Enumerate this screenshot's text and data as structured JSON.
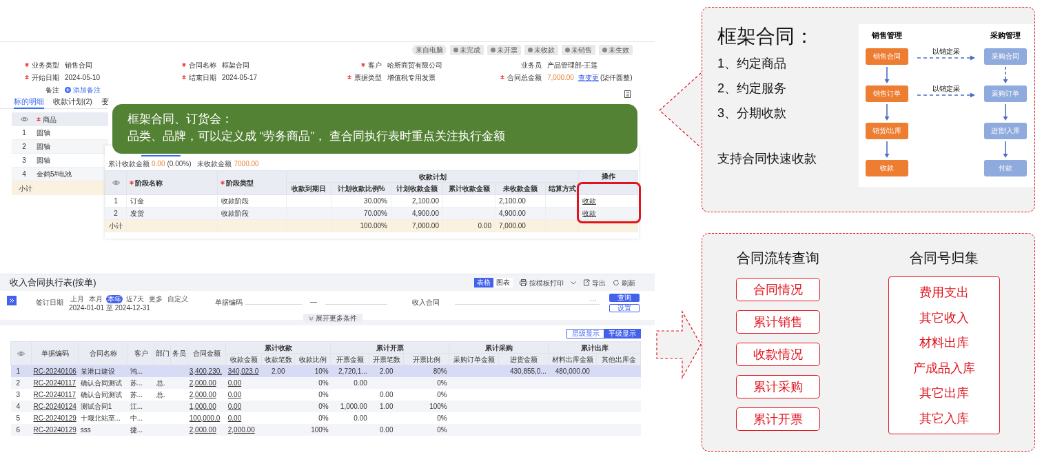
{
  "contract": {
    "status_tags": [
      {
        "label": "来自电脑",
        "kind": "source"
      },
      {
        "label": "未完成",
        "kind": "status"
      },
      {
        "label": "未开票",
        "kind": "status"
      },
      {
        "label": "未收款",
        "kind": "status"
      },
      {
        "label": "未销售",
        "kind": "status"
      },
      {
        "label": "未生效",
        "kind": "status"
      }
    ],
    "fields": [
      {
        "label": "业务类型",
        "value": "销售合同",
        "required": true,
        "kind": "text"
      },
      {
        "label": "合同名称",
        "value": "框架合同",
        "required": true,
        "kind": "text"
      },
      {
        "label": "客户",
        "value": "哈斯商贸有限公司",
        "required": true,
        "kind": "text"
      },
      {
        "label": "业务员",
        "value": "产品管理部-王莲",
        "required": false,
        "kind": "text"
      },
      {
        "label": "开始日期",
        "value": "2024-05-10",
        "required": true,
        "kind": "text"
      },
      {
        "label": "结束日期",
        "value": "2024-05-17",
        "required": true,
        "kind": "text"
      },
      {
        "label": "票据类型",
        "value": "增值税专用发票",
        "required": true,
        "kind": "text"
      },
      {
        "label": "合同总金额",
        "value": "7,000.00",
        "required": true,
        "kind": "amount",
        "link": "查变更",
        "note": "(柒仟圆整)"
      },
      {
        "label": "备注",
        "required": false,
        "kind": "action",
        "action": "添加备注"
      }
    ],
    "tabs": [
      {
        "label": "标的明细",
        "selected": true
      },
      {
        "label": "收款计划(2)",
        "selected": false
      },
      {
        "label": "变",
        "selected": false
      }
    ],
    "product_table": {
      "column": {
        "label": "商品",
        "required": true
      },
      "rows": [
        {
          "index": "1",
          "product": "圆轴"
        },
        {
          "index": "2",
          "product": "圆轴"
        },
        {
          "index": "3",
          "product": "圆轴"
        },
        {
          "index": "4",
          "product": "金鹤5#电池"
        }
      ],
      "subtotal_label": "小计"
    }
  },
  "payment_plan": {
    "summary": {
      "received_label": "累计收款金额",
      "received_value": "0.00",
      "received_pct": "(0.00%)",
      "outstanding_label": "未收款金额",
      "outstanding_value": "7000.00"
    },
    "group_header": "收款计划",
    "columns": [
      {
        "label": "阶段名称",
        "required": true,
        "kind": "text",
        "highlighted": false
      },
      {
        "label": "阶段类型",
        "required": true,
        "kind": "text",
        "highlighted": false
      },
      {
        "label": "收款到期日",
        "required": false,
        "kind": "text",
        "highlighted": false
      },
      {
        "label": "计划收款比例%",
        "required": false,
        "kind": "number",
        "highlighted": false
      },
      {
        "label": "计划收款金额",
        "required": false,
        "kind": "number",
        "highlighted": false
      },
      {
        "label": "累计收款金额",
        "required": false,
        "kind": "number",
        "highlighted": false
      },
      {
        "label": "未收款金额",
        "required": false,
        "kind": "text",
        "highlighted": false
      },
      {
        "label": "结算方式",
        "required": false,
        "kind": "text",
        "highlighted": false
      },
      {
        "label": "操作",
        "required": false,
        "kind": "action",
        "highlighted": true
      }
    ],
    "rows": [
      {
        "index": "1",
        "cells": [
          "订金",
          "收款阶段",
          null,
          "30.00%",
          "2,100.00",
          null,
          "2,100.00",
          null,
          "收款"
        ]
      },
      {
        "index": "2",
        "cells": [
          "发货",
          "收款阶段",
          null,
          "70.00%",
          "4,900.00",
          null,
          "4,900.00",
          null,
          "收款"
        ]
      }
    ],
    "subtotal": {
      "label": "小计",
      "cells": [
        null,
        null,
        null,
        "100.00%",
        "7,000.00",
        "0.00",
        "7,000.00",
        null,
        null
      ]
    }
  },
  "callout": {
    "title": "框架合同、订货会：",
    "body": "品类、品牌，可以定义成 “劳务商品”， 查合同执行表时重点关注执行金额"
  },
  "report": {
    "title": "收入合同执行表(按单)",
    "view_tabs": [
      {
        "label": "表格",
        "selected": true
      },
      {
        "label": "图表",
        "selected": false
      }
    ],
    "toolbar": [
      {
        "label": "按模板打印",
        "kind": "print"
      },
      {
        "label": "导出",
        "kind": "export"
      },
      {
        "label": "刷新",
        "kind": "refresh"
      }
    ],
    "filters": {
      "date_label": "签订日期",
      "date_presets": [
        {
          "label": "上月",
          "selected": false
        },
        {
          "label": "本月",
          "selected": false
        },
        {
          "label": "本年",
          "selected": true
        },
        {
          "label": "近7天",
          "selected": false
        },
        {
          "label": "更多",
          "selected": false
        },
        {
          "label": "自定义",
          "selected": false
        }
      ],
      "date_range": "2024-01-01 至 2024-12-31",
      "code_label": "单据编码",
      "range_separator": "—",
      "contract_label": "收入合同",
      "contract_more": "···"
    },
    "buttons": [
      {
        "label": "查询",
        "kind": "primary"
      },
      {
        "label": "设置",
        "kind": "secondary"
      }
    ],
    "expand_label": "展开更多条件",
    "display_modes": [
      {
        "label": "层级显示",
        "selected": false
      },
      {
        "label": "平级显示",
        "selected": true
      }
    ],
    "table": {
      "leading_columns": [
        {
          "label": "单据编码",
          "kind": "link"
        },
        {
          "label": "合同名称",
          "kind": "text"
        },
        {
          "label": "客户",
          "kind": "text"
        },
        {
          "label": "部门",
          "kind": "text"
        },
        {
          "label": "务员",
          "kind": "text"
        },
        {
          "label": "合同金额",
          "kind": "link"
        }
      ],
      "groups": [
        {
          "label": "累计收款",
          "columns": [
            {
              "label": "收款金额",
              "kind": "link"
            },
            {
              "label": "收款笔数",
              "kind": "count"
            },
            {
              "label": "收款比例",
              "kind": "number"
            }
          ]
        },
        {
          "label": "累计开票",
          "columns": [
            {
              "label": "开票金额",
              "kind": "number"
            },
            {
              "label": "开票笔数",
              "kind": "count"
            },
            {
              "label": "开票比例",
              "kind": "number"
            }
          ]
        },
        {
          "label": "累计采购",
          "columns": [
            {
              "label": "采购订单金额",
              "kind": "number"
            },
            {
              "label": "进货金额",
              "kind": "number"
            }
          ]
        },
        {
          "label": "累计出库",
          "columns": [
            {
              "label": "材料出库金额",
              "kind": "count"
            },
            {
              "label": "其他出库金",
              "kind": "number"
            }
          ]
        }
      ],
      "rows": [
        {
          "index": "1",
          "selected": true,
          "cells": [
            "RC-20240106",
            "某港口建设",
            "鸿...",
            null,
            null,
            "3,400,230.",
            "340,023.0",
            "2.00",
            "10%",
            "2,720,1...",
            "2.00",
            "80%",
            null,
            "430,855,0...",
            "480,000.00",
            null
          ]
        },
        {
          "index": "2",
          "selected": false,
          "cells": [
            "RC-20240117",
            "确认合同测试",
            "苏...",
            "总.",
            null,
            "2,000.00",
            "0.00",
            null,
            "0%",
            "0.00",
            null,
            "0%",
            null,
            null,
            null,
            null
          ]
        },
        {
          "index": "3",
          "selected": false,
          "cells": [
            "RC-20240117",
            "确认合同测试",
            "苏...",
            "总.",
            null,
            "2,000.00",
            "0.00",
            null,
            "0%",
            null,
            "0.00",
            "0%",
            null,
            null,
            null,
            null
          ]
        },
        {
          "index": "4",
          "selected": false,
          "cells": [
            "RC-20240124",
            "测试合同1",
            "江...",
            null,
            null,
            "1,000.00",
            "0.00",
            null,
            "0%",
            "1,000.00",
            "1.00",
            "100%",
            null,
            null,
            null,
            null
          ]
        },
        {
          "index": "5",
          "selected": false,
          "cells": [
            "RC-20240129",
            "十堰北站至...",
            "中...",
            null,
            null,
            "100,000.0",
            "0.00",
            null,
            "0%",
            "0.00",
            null,
            "0%",
            null,
            null,
            null,
            null
          ]
        },
        {
          "index": "6",
          "selected": false,
          "cells": [
            "RC-20240129",
            "sss",
            "捷...",
            null,
            null,
            "2,000.00",
            "2,000.00",
            null,
            "100%",
            null,
            "0.00",
            "0%",
            null,
            null,
            null,
            null
          ]
        }
      ]
    }
  },
  "framework_panel": {
    "title": "框架合同：",
    "points": [
      "1、约定商品",
      "2、约定服务",
      "3、分期收款"
    ],
    "footer": "支持合同快速收款",
    "flow": {
      "sales": {
        "heading": "销售管理",
        "steps": [
          "销售合同",
          "销售订单",
          "销货/出库",
          "收款"
        ]
      },
      "purchase": {
        "heading": "采购管理",
        "steps": [
          "采购合同",
          "采购订单",
          "进货/入库",
          "付款"
        ]
      },
      "links": [
        "以销定采",
        "以销定采"
      ]
    }
  },
  "query_panel": {
    "left": {
      "heading": "合同流转查询",
      "items": [
        "合同情况",
        "累计销售",
        "收款情况",
        "累计采购",
        "累计开票"
      ]
    },
    "right": {
      "heading": "合同号归集",
      "items": [
        "费用支出",
        "其它收入",
        "材料出库",
        "产成品入库",
        "其它出库",
        "其它入库"
      ]
    }
  }
}
